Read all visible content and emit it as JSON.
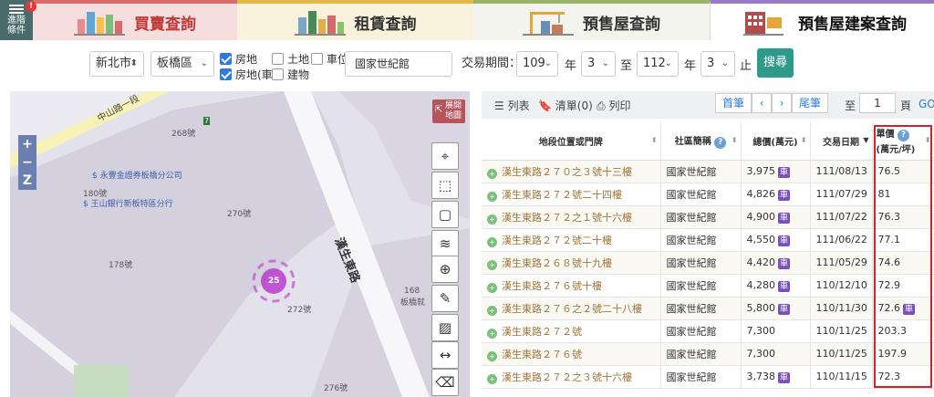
{
  "topbar": {
    "advanced": {
      "line1": "進階",
      "line2": "條件",
      "badge": "!"
    },
    "tabs": [
      {
        "label": "買賣查詢",
        "icon": "city-buildings-icon"
      },
      {
        "label": "租賃查詢",
        "icon": "rental-buildings-icon"
      },
      {
        "label": "預售屋查詢",
        "icon": "construction-crane-icon"
      },
      {
        "label": "預售屋建案查詢",
        "icon": "presale-building-icon"
      }
    ]
  },
  "filter": {
    "city": "新北市",
    "district": "板橋區",
    "types": [
      {
        "label": "房地",
        "checked": true
      },
      {
        "label": "土地",
        "checked": false
      },
      {
        "label": "車位",
        "checked": false
      },
      {
        "label": "房地(車)",
        "checked": true
      },
      {
        "label": "建物",
        "checked": false
      }
    ],
    "keyword": "國家世紀館",
    "period_label": "交易期間：",
    "from_year": "109",
    "year_unit": "年",
    "from_month": "3",
    "to_label": "至",
    "to_year": "112",
    "to_month": "3",
    "end_label": "止",
    "search_button": "搜尋"
  },
  "map": {
    "road_label": "中山路一段",
    "road2_label": "漢生東路",
    "zoom_in": "+",
    "zoom_out": "−",
    "zoom_z": "Z",
    "expand": {
      "line1": "展開",
      "line2": "地圖"
    },
    "cluster_count": "25",
    "labels": {
      "n268": "268號",
      "bank1": "永豐金證券板橋分公司",
      "n180": "180號",
      "bank2": "王山銀行新板特區分行",
      "n270": "270號",
      "n178": "178號",
      "n272": "272號",
      "n276": "276號",
      "n168": "168",
      "banqiao": "板橋就"
    }
  },
  "panel": {
    "list_label": "列表",
    "bookmark_label": "清單(0)",
    "print_label": "列印",
    "first_page": "首筆",
    "prev": "‹",
    "next": "›",
    "last_page": "尾筆",
    "goto_label": "至",
    "page_number": "1",
    "page_unit": "頁",
    "go": "GO"
  },
  "table": {
    "headers": {
      "location": "地段位置或門牌",
      "community": "社區簡稱",
      "total": "總價(萬元)",
      "date": "交易日期",
      "unit_price_l1": "單價",
      "unit_price_l2": "(萬元/坪)"
    },
    "rows": [
      {
        "location": "漢生東路２７０之３號十三樓",
        "community": "國家世紀館",
        "total": "3,975",
        "total_car": true,
        "date": "111/08/13",
        "unit": "76.5",
        "unit_car": false
      },
      {
        "location": "漢生東路２７２號二十四樓",
        "community": "國家世紀館",
        "total": "4,826",
        "total_car": true,
        "date": "111/07/29",
        "unit": "81",
        "unit_car": false
      },
      {
        "location": "漢生東路２７２之１號十六樓",
        "community": "國家世紀館",
        "total": "4,900",
        "total_car": true,
        "date": "111/07/22",
        "unit": "76.3",
        "unit_car": false
      },
      {
        "location": "漢生東路２７２號二十樓",
        "community": "國家世紀館",
        "total": "4,550",
        "total_car": true,
        "date": "111/06/22",
        "unit": "77.1",
        "unit_car": false
      },
      {
        "location": "漢生東路２６８號十九樓",
        "community": "國家世紀館",
        "total": "4,420",
        "total_car": true,
        "date": "111/05/29",
        "unit": "74.6",
        "unit_car": false
      },
      {
        "location": "漢生東路２７６號十樓",
        "community": "國家世紀館",
        "total": "4,280",
        "total_car": true,
        "date": "110/12/10",
        "unit": "72.9",
        "unit_car": false
      },
      {
        "location": "漢生東路２７６之２號二十八樓",
        "community": "國家世紀館",
        "total": "5,800",
        "total_car": true,
        "date": "110/11/30",
        "unit": "72.6",
        "unit_car": true
      },
      {
        "location": "漢生東路２７２號",
        "community": "國家世紀館",
        "total": "7,300",
        "total_car": false,
        "date": "110/11/25",
        "unit": "203.3",
        "unit_car": false
      },
      {
        "location": "漢生東路２７６號",
        "community": "國家世紀館",
        "total": "7,300",
        "total_car": false,
        "date": "110/11/25",
        "unit": "197.9",
        "unit_car": false
      },
      {
        "location": "漢生東路２７２之３號十六樓",
        "community": "國家世紀館",
        "total": "3,738",
        "total_car": true,
        "date": "110/11/15",
        "unit": "72.3",
        "unit_car": false
      }
    ],
    "car_tag": "車"
  }
}
